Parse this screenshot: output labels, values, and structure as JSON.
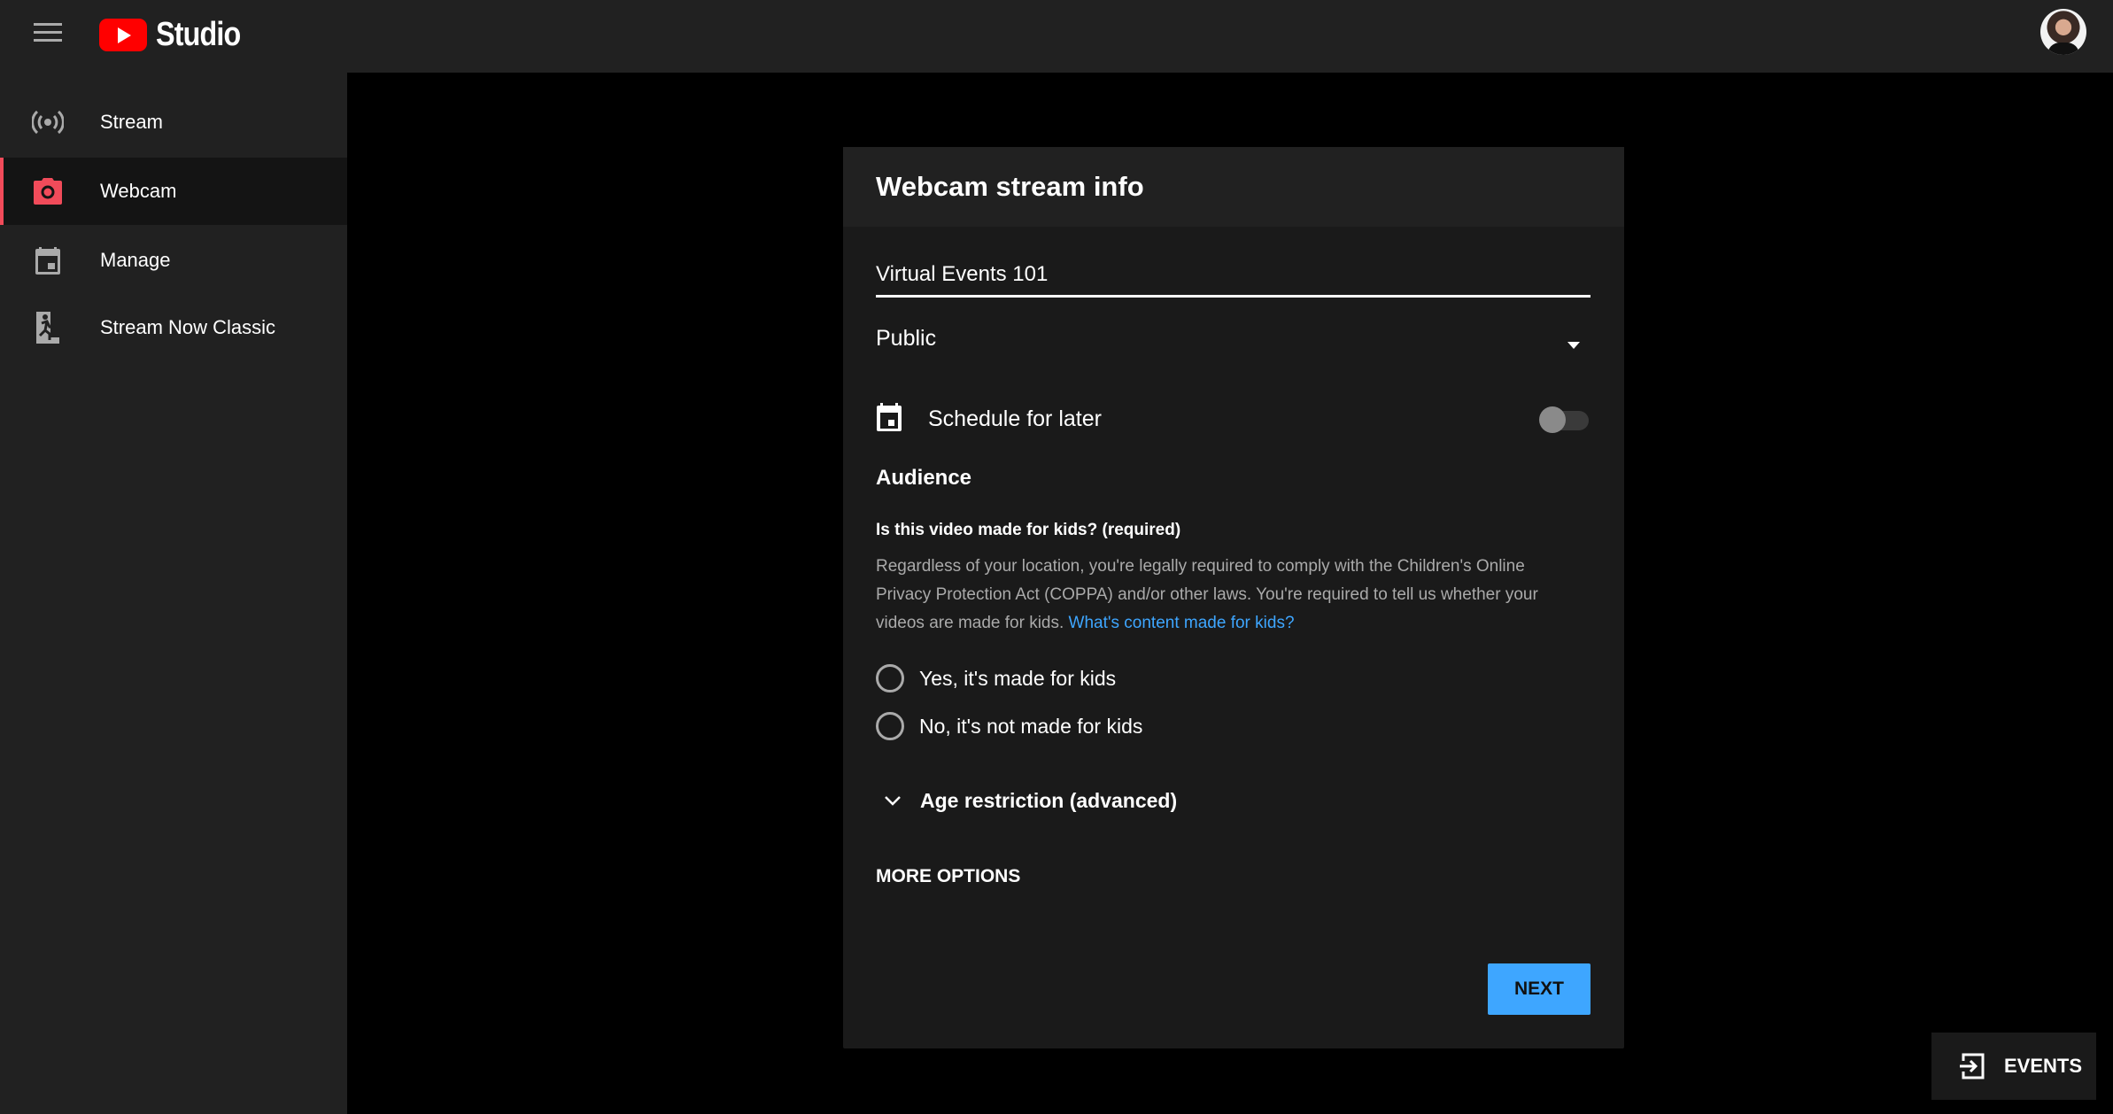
{
  "app": {
    "title": "Studio",
    "menu_icon": "hamburger-menu-icon",
    "logo_icon": "youtube-play-icon",
    "avatar_icon": "user-avatar"
  },
  "sidebar": {
    "items": [
      {
        "label": "Stream",
        "icon": "live-broadcast-icon",
        "active": false
      },
      {
        "label": "Webcam",
        "icon": "camera-icon",
        "active": true
      },
      {
        "label": "Manage",
        "icon": "calendar-icon",
        "active": false
      },
      {
        "label": "Stream Now Classic",
        "icon": "exit-run-icon",
        "active": false
      }
    ]
  },
  "colors": {
    "accent_active": "#f14b5a",
    "primary_button": "#3ea6ff",
    "link": "#3ea6ff"
  },
  "dialog": {
    "title": "Webcam stream info",
    "stream_title_value": "Virtual Events 101",
    "privacy": {
      "selected": "Public",
      "icon": "dropdown-caret-icon"
    },
    "schedule": {
      "label": "Schedule for later",
      "icon": "calendar-icon",
      "enabled": false
    },
    "audience": {
      "heading": "Audience",
      "question": "Is this video made for kids? (required)",
      "description": "Regardless of your location, you're legally required to comply with the Children's Online Privacy Protection Act (COPPA) and/or other laws. You're required to tell us whether your videos are made for kids.",
      "link_text": "What's content made for kids?",
      "options": [
        {
          "label": "Yes, it's made for kids",
          "selected": false
        },
        {
          "label": "No, it's not made for kids",
          "selected": false
        }
      ]
    },
    "age_restriction": {
      "label": "Age restriction (advanced)",
      "icon": "chevron-down-icon"
    },
    "more_options_label": "MORE OPTIONS",
    "next_label": "NEXT"
  },
  "events_button": {
    "label": "EVENTS",
    "icon": "enter-arrow-icon"
  }
}
